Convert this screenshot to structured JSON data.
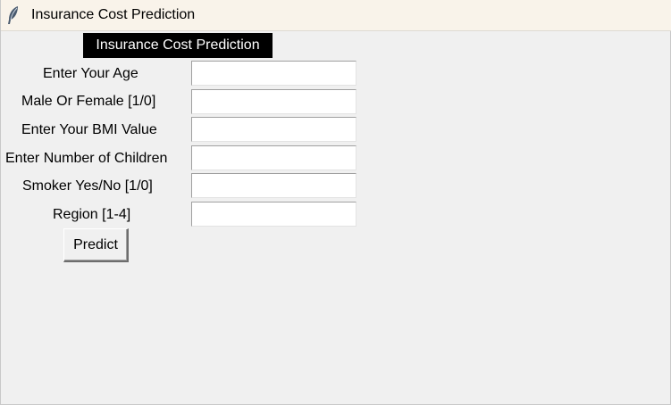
{
  "window": {
    "title": "Insurance Cost Prediction",
    "icon": "feather-icon"
  },
  "form": {
    "heading": "Insurance Cost Prediction",
    "fields": [
      {
        "label": "Enter Your Age",
        "value": ""
      },
      {
        "label": "Male Or Female [1/0]",
        "value": ""
      },
      {
        "label": "Enter Your BMI Value",
        "value": ""
      },
      {
        "label": "Enter Number of Children",
        "value": ""
      },
      {
        "label": "Smoker Yes/No [1/0]",
        "value": ""
      },
      {
        "label": "Region [1-4]",
        "value": ""
      }
    ],
    "predict_label": "Predict"
  },
  "colors": {
    "background": "#f0f0f0",
    "titlebar": "#f9f3ea",
    "heading_bg": "#000000",
    "heading_fg": "#ffffff",
    "field_bg": "#ffffff"
  }
}
